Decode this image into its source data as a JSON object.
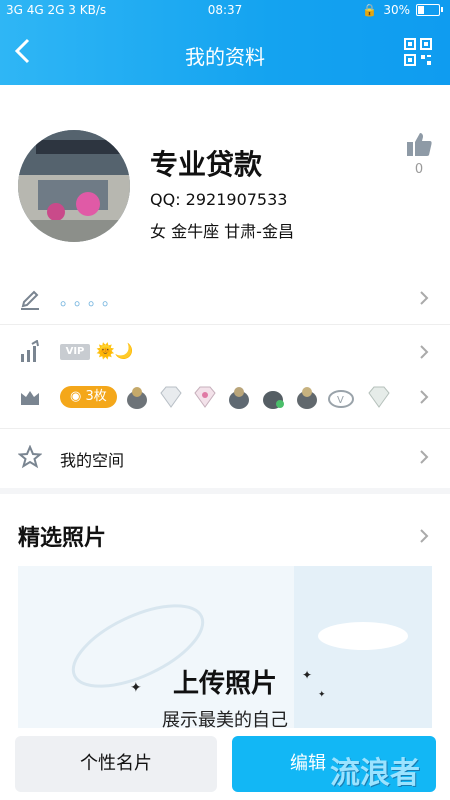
{
  "status_bar": {
    "network": "3G 4G 2G",
    "speed": "3 KB/s",
    "time": "08:37",
    "battery": "30%",
    "battery_level": 0.3
  },
  "header": {
    "title": "我的资料"
  },
  "profile": {
    "name": "专业贷款",
    "qq": "QQ:  2921907533",
    "info": "女  金牛座  甘肃-金昌",
    "like_count": "0"
  },
  "rows": {
    "signature": "。。。。",
    "vip_badge": "VIP",
    "sun_moon": "🌞🌙",
    "medal_count": "3枚",
    "space_label": "我的空间"
  },
  "photos": {
    "section_title": "精选照片",
    "upload_title": "上传照片",
    "upload_subtitle": "展示最美的自己"
  },
  "bottom": {
    "card_label": "个性名片",
    "edit_label": "编辑"
  },
  "watermark": "流浪者",
  "colors": {
    "accent": "#12b7f5",
    "header": "#14a3f0",
    "medal_badge": "#f4a71a"
  }
}
